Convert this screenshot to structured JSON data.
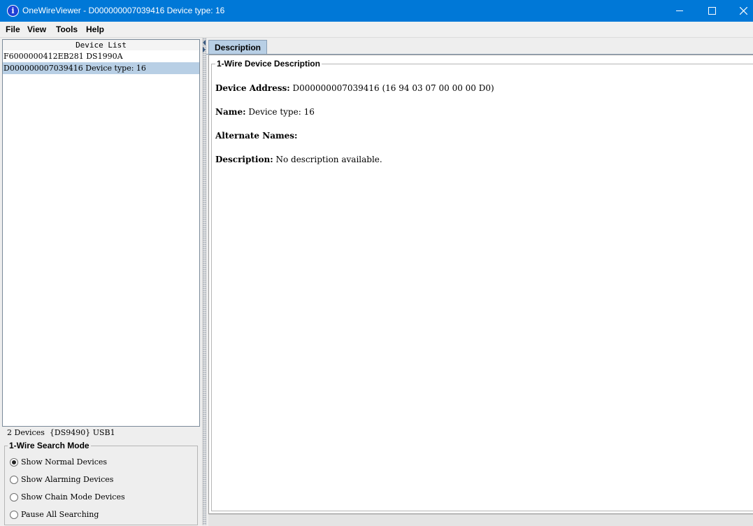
{
  "window": {
    "title": "OneWireViewer - D000000007039416 Device type: 16",
    "icon_glyph": "i",
    "icon_name": "info-icon"
  },
  "menu": [
    "File",
    "View",
    "Tools",
    "Help"
  ],
  "device_list": {
    "header": "Device List",
    "items": [
      "F6000000412EB281 DS1990A",
      "D000000007039416 Device type: 16"
    ],
    "selected_index": 1
  },
  "status": {
    "count": "2 Devices",
    "adapter": "{DS9490} USB1"
  },
  "search_mode": {
    "legend": "1-Wire Search Mode",
    "options": [
      {
        "label": "Show Normal Devices",
        "checked": true
      },
      {
        "label": "Show Alarming Devices",
        "checked": false
      },
      {
        "label": "Show Chain Mode Devices",
        "checked": false
      },
      {
        "label": "Pause All Searching",
        "checked": false
      }
    ]
  },
  "tabs": [
    "Description"
  ],
  "description": {
    "legend": "1-Wire Device Description",
    "address_label": "Device Address:",
    "address_value": "D000000007039416 (16 94 03 07 00 00 00 D0)",
    "name_label": "Name:",
    "name_value": "Device type: 16",
    "alt_label": "Alternate Names:",
    "alt_value": "",
    "desc_label": "Description:",
    "desc_value": "No description available."
  },
  "colors": {
    "titlebar": "#0078d7",
    "selection": "#b8cfe5"
  }
}
